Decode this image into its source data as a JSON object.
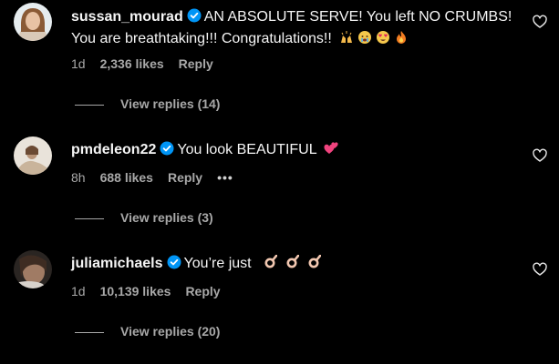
{
  "comments": [
    {
      "username": "sussan_mourad",
      "text": "AN ABSOLUTE SERVE! You left NO CRUMBS! You are breathtaking!!! Congratulations!!",
      "emojis": [
        "raising-hands-emoji",
        "crying-face-emoji",
        "heart-eyes-emoji",
        "fire-emoji"
      ],
      "time": "1d",
      "likes": "2,336 likes",
      "reply": "Reply",
      "view_replies": "View replies (14)"
    },
    {
      "username": "pmdeleon22",
      "text": "You look BEAUTIFUL",
      "emojis": [
        "two-hearts-emoji"
      ],
      "time": "8h",
      "likes": "688 likes",
      "reply": "Reply",
      "more": "•••",
      "view_replies": "View replies (3)"
    },
    {
      "username": "juliamichaels",
      "text": "You’re just",
      "emojis": [
        "ok-hand-emoji",
        "ok-hand-emoji",
        "ok-hand-emoji"
      ],
      "time": "1d",
      "likes": "10,139 likes",
      "reply": "Reply",
      "view_replies": "View replies (20)"
    }
  ],
  "colors": {
    "background": "#000000",
    "primary_text": "#f5f5f5",
    "secondary_text": "#a8a8a8",
    "verified_blue": "#0095f6"
  }
}
